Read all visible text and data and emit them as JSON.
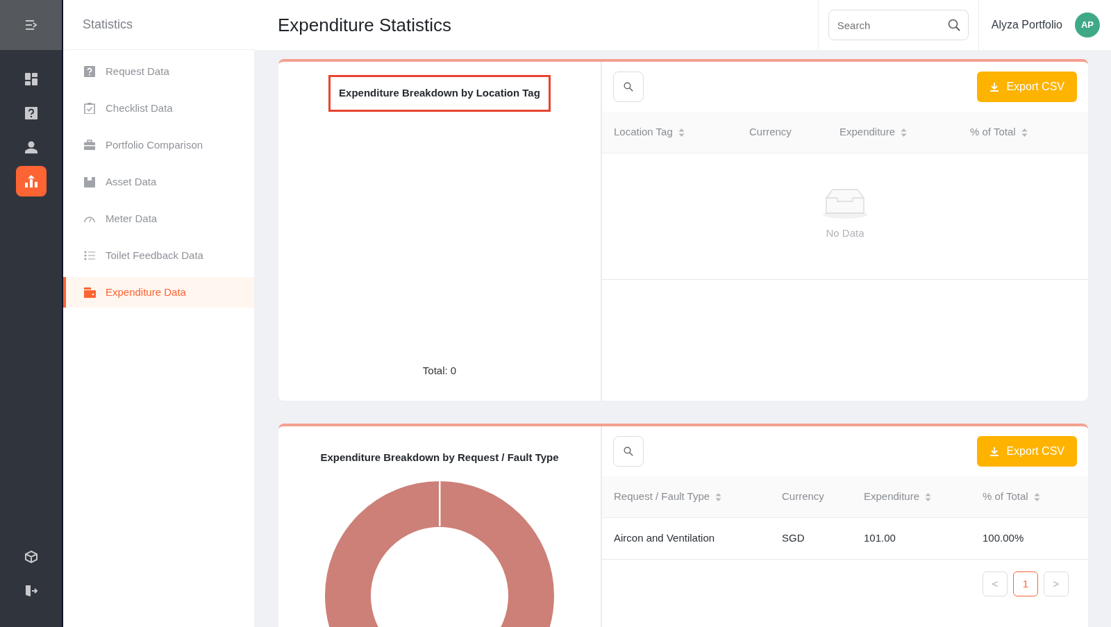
{
  "rail": {
    "items": [
      {
        "selected": false
      },
      {
        "selected": false
      },
      {
        "selected": false
      },
      {
        "selected": true
      }
    ],
    "bottom_items": [
      {
        "selected": false
      },
      {
        "selected": false
      }
    ]
  },
  "submenu": {
    "title": "Statistics",
    "items": [
      {
        "label": "Request Data",
        "selected": false
      },
      {
        "label": "Checklist Data",
        "selected": false
      },
      {
        "label": "Portfolio Comparison",
        "selected": false
      },
      {
        "label": "Asset Data",
        "selected": false
      },
      {
        "label": "Meter Data",
        "selected": false
      },
      {
        "label": "Toilet Feedback Data",
        "selected": false
      },
      {
        "label": "Expenditure Data",
        "selected": true
      }
    ]
  },
  "header": {
    "title": "Expenditure Statistics",
    "search": {
      "placeholder": "Search"
    },
    "user": {
      "name": "Alyza Portfolio",
      "initials": "AP"
    }
  },
  "panels": [
    {
      "chart_title": "Expenditure Breakdown by Location Tag",
      "title_highlighted": true,
      "chart": {
        "kind": "empty"
      },
      "total": "Total: 0",
      "export_label": "Export CSV",
      "columns": [
        {
          "label": "Location Tag",
          "sortable": true
        },
        {
          "label": "Currency",
          "sortable": false
        },
        {
          "label": "Expenditure",
          "sortable": true
        },
        {
          "label": "% of Total",
          "sortable": true
        }
      ],
      "empty_text": "No Data"
    },
    {
      "chart_title": "Expenditure Breakdown by Request / Fault Type",
      "title_highlighted": false,
      "chart": {
        "kind": "donut"
      },
      "export_label": "Export CSV",
      "columns": [
        {
          "label": "Request / Fault Type",
          "sortable": true
        },
        {
          "label": "Currency",
          "sortable": false
        },
        {
          "label": "Expenditure",
          "sortable": true
        },
        {
          "label": "% of Total",
          "sortable": true
        }
      ],
      "rows": [
        [
          "Aircon and Ventilation",
          "SGD",
          "101.00",
          "100.00%"
        ]
      ],
      "pagination": {
        "prev": "<",
        "next": ">",
        "pages": [
          {
            "label": "1",
            "selected": true
          }
        ]
      }
    }
  ]
}
